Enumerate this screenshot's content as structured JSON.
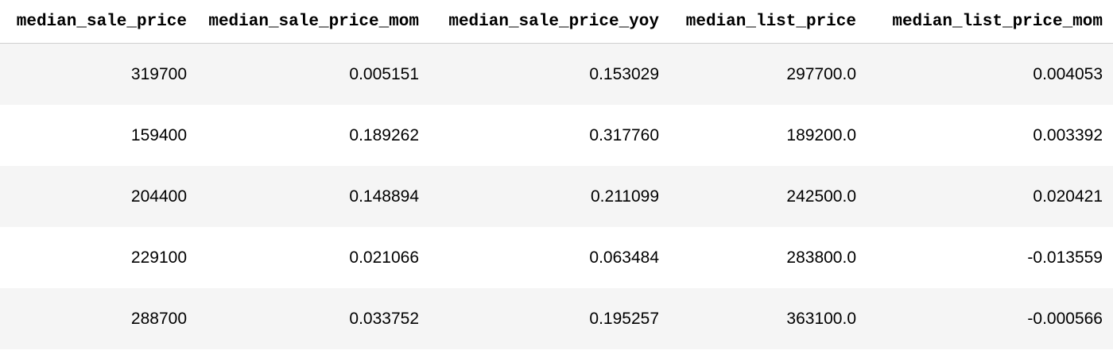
{
  "table": {
    "columns": [
      "median_sale_price",
      "median_sale_price_mom",
      "median_sale_price_yoy",
      "median_list_price",
      "median_list_price_mom"
    ],
    "rows": [
      [
        "319700",
        "0.005151",
        "0.153029",
        "297700.0",
        "0.004053"
      ],
      [
        "159400",
        "0.189262",
        "0.317760",
        "189200.0",
        "0.003392"
      ],
      [
        "204400",
        "0.148894",
        "0.211099",
        "242500.0",
        "0.020421"
      ],
      [
        "229100",
        "0.021066",
        "0.063484",
        "283800.0",
        "-0.013559"
      ],
      [
        "288700",
        "0.033752",
        "0.195257",
        "363100.0",
        "-0.000566"
      ]
    ]
  },
  "colors": {
    "stripe": "#f5f5f5",
    "header_rule": "#cfcfcf",
    "text": "#000000"
  }
}
